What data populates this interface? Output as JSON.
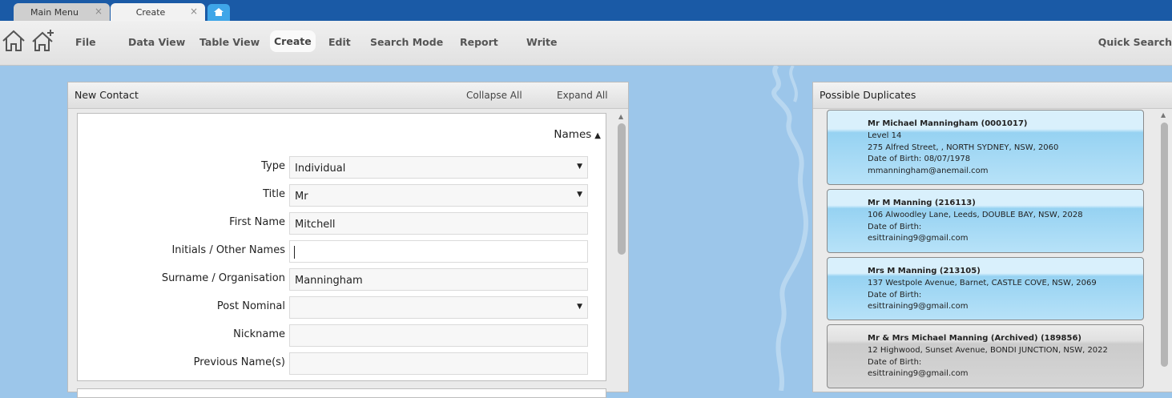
{
  "tabs": [
    {
      "label": "Main Menu"
    },
    {
      "label": "Create"
    }
  ],
  "tab_close_glyph": "×",
  "menu": {
    "items": [
      "File",
      "Data View",
      "Table View",
      "Create",
      "Edit",
      "Search Mode",
      "Report",
      "Write"
    ],
    "active": "Create",
    "quick_search": "Quick Search"
  },
  "new_contact": {
    "title": "New Contact",
    "collapse_all": "Collapse All",
    "expand_all": "Expand All",
    "section": "Names",
    "fields": [
      {
        "label": "Type",
        "value": "Individual",
        "dropdown": true
      },
      {
        "label": "Title",
        "value": "Mr",
        "dropdown": true
      },
      {
        "label": "First Name",
        "value": "Mitchell",
        "dropdown": false
      },
      {
        "label": "Initials / Other Names",
        "value": "",
        "dropdown": false,
        "focused": true
      },
      {
        "label": "Surname / Organisation",
        "value": "Manningham",
        "dropdown": false
      },
      {
        "label": "Post Nominal",
        "value": "",
        "dropdown": true
      },
      {
        "label": "Nickname",
        "value": "",
        "dropdown": false
      },
      {
        "label": "Previous Name(s)",
        "value": "",
        "dropdown": false
      }
    ]
  },
  "duplicates": {
    "title": "Possible Duplicates",
    "items": [
      {
        "name": "Mr Michael Manningham (0001017)",
        "lines": [
          "Level 14",
          "275 Alfred Street, , NORTH SYDNEY, NSW, 2060",
          "Date of Birth: 08/07/1978",
          "mmanningham@anemail.com"
        ],
        "archived": false
      },
      {
        "name": "Mr M Manning (216113)",
        "lines": [
          "106 Alwoodley Lane, Leeds, DOUBLE BAY, NSW, 2028",
          "Date of Birth:",
          "esittraining9@gmail.com"
        ],
        "archived": false
      },
      {
        "name": "Mrs M Manning (213105)",
        "lines": [
          "137 Westpole Avenue, Barnet, CASTLE COVE, NSW, 2069",
          "Date of Birth:",
          "esittraining9@gmail.com"
        ],
        "archived": false
      },
      {
        "name": "Mr & Mrs Michael Manning (Archived) (189856)",
        "lines": [
          "12 Highwood, Sunset Avenue, BONDI JUNCTION, NSW, 2022",
          "Date of Birth:",
          "esittraining9@gmail.com"
        ],
        "archived": true
      }
    ]
  },
  "colors": {
    "tabbar": "#1a5aa6",
    "background": "#9cc6ea",
    "dup_card": "#b7e2f8",
    "archived_card": "#d6d6d6"
  },
  "icons": [
    "home-icon",
    "add-home-icon",
    "home-tab-icon",
    "chevron-up-icon",
    "dropdown-arrow-icon",
    "close-icon"
  ]
}
